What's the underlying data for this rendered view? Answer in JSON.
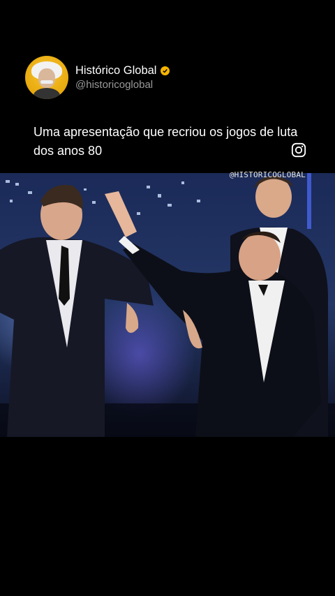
{
  "profile": {
    "name": "Histórico Global",
    "handle": "@historicoglobal"
  },
  "post": {
    "caption": "Uma apresentação que recriou os jogos de luta dos anos 80"
  },
  "video": {
    "watermark": "@HISTORICOGLOBAL"
  },
  "icons": {
    "verified": "verified-badge-icon",
    "instagram": "instagram-icon"
  },
  "colors": {
    "background": "#000000",
    "verified": "#f5b400",
    "handle": "#9a9a9a"
  }
}
